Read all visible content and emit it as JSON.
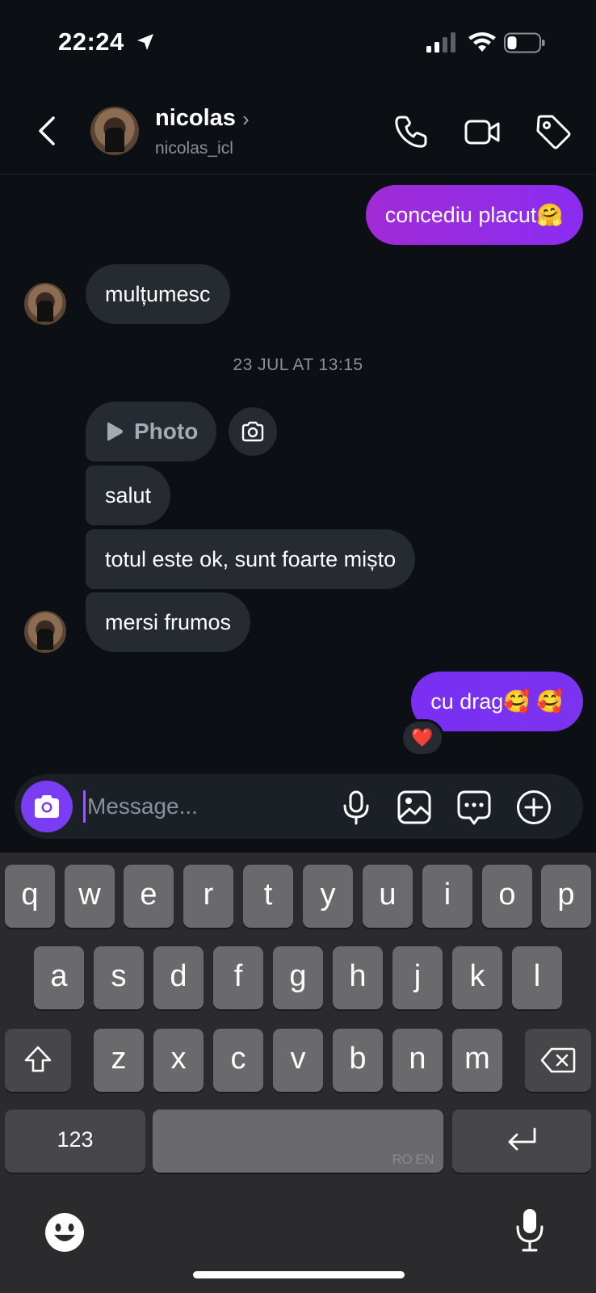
{
  "status_bar": {
    "time": "22:24",
    "battery_percent": 30
  },
  "header": {
    "name": "nicolas",
    "handle": "nicolas_icl"
  },
  "messages": [
    {
      "direction": "outgoing",
      "text": "concediu placut🤗"
    },
    {
      "direction": "incoming",
      "text": "mulțumesc"
    },
    {
      "direction": "incoming",
      "text": "Photo",
      "type": "photo"
    },
    {
      "direction": "incoming",
      "text": "salut"
    },
    {
      "direction": "incoming",
      "text": "totul este ok, sunt foarte mișto"
    },
    {
      "direction": "incoming",
      "text": "mersi frumos"
    },
    {
      "direction": "outgoing",
      "text": "cu drag🥰 🥰",
      "reaction": "❤️"
    }
  ],
  "timestamp": "23 JUL AT 13:15",
  "composer": {
    "placeholder": "Message..."
  },
  "keyboard": {
    "row1": [
      "q",
      "w",
      "e",
      "r",
      "t",
      "y",
      "u",
      "i",
      "o",
      "p"
    ],
    "row2": [
      "a",
      "s",
      "d",
      "f",
      "g",
      "h",
      "j",
      "k",
      "l"
    ],
    "row3": [
      "z",
      "x",
      "c",
      "v",
      "b",
      "n",
      "m"
    ],
    "numbers_label": "123",
    "language": "RO EN"
  },
  "colors": {
    "outgoing_bubble": "#9b2de0",
    "incoming_bubble": "#262a31",
    "accent": "#7b3cf5",
    "background": "#0c0f14"
  }
}
